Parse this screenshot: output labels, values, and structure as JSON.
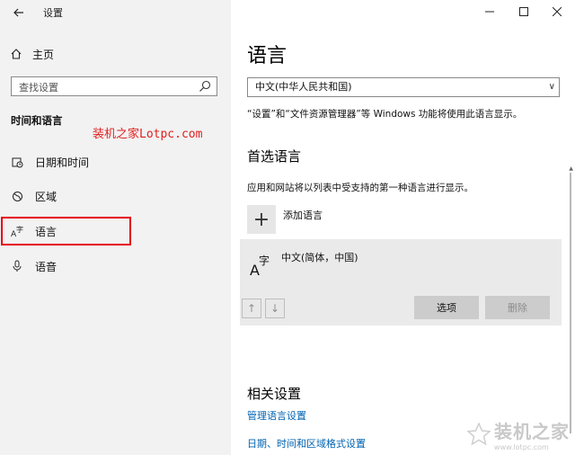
{
  "window": {
    "title": "设置"
  },
  "sidebar": {
    "home_label": "主页",
    "search_placeholder": "查找设置",
    "section_title": "时间和语言",
    "items": [
      {
        "label": "日期和时间",
        "icon": "calendar-clock-icon"
      },
      {
        "label": "区域",
        "icon": "region-icon"
      },
      {
        "label": "语言",
        "icon": "language-icon",
        "selected": true
      },
      {
        "label": "语音",
        "icon": "microphone-icon"
      }
    ],
    "watermark": "装机之家Lotpc.com"
  },
  "main": {
    "title": "语言",
    "display_language": "中文(中华人民共和国)",
    "display_language_desc": "“设置”和“文件资源管理器”等 Windows 功能将使用此语言显示。",
    "preferred_heading": "首选语言",
    "preferred_desc": "应用和网站将以列表中受支持的第一种语言进行显示。",
    "add_language_label": "添加语言",
    "languages": [
      {
        "name": "中文(简体，中国)"
      }
    ],
    "options_label": "选项",
    "remove_label": "删除",
    "related_heading": "相关设置",
    "links": [
      "管理语言设置",
      "日期、时间和区域格式设置"
    ]
  },
  "corner_watermark": {
    "title": "装机之家",
    "url": "www.lotpc.com"
  },
  "colors": {
    "accent_link": "#0063b1",
    "highlight_border": "#e60012",
    "watermark_red": "#e21e1e"
  }
}
